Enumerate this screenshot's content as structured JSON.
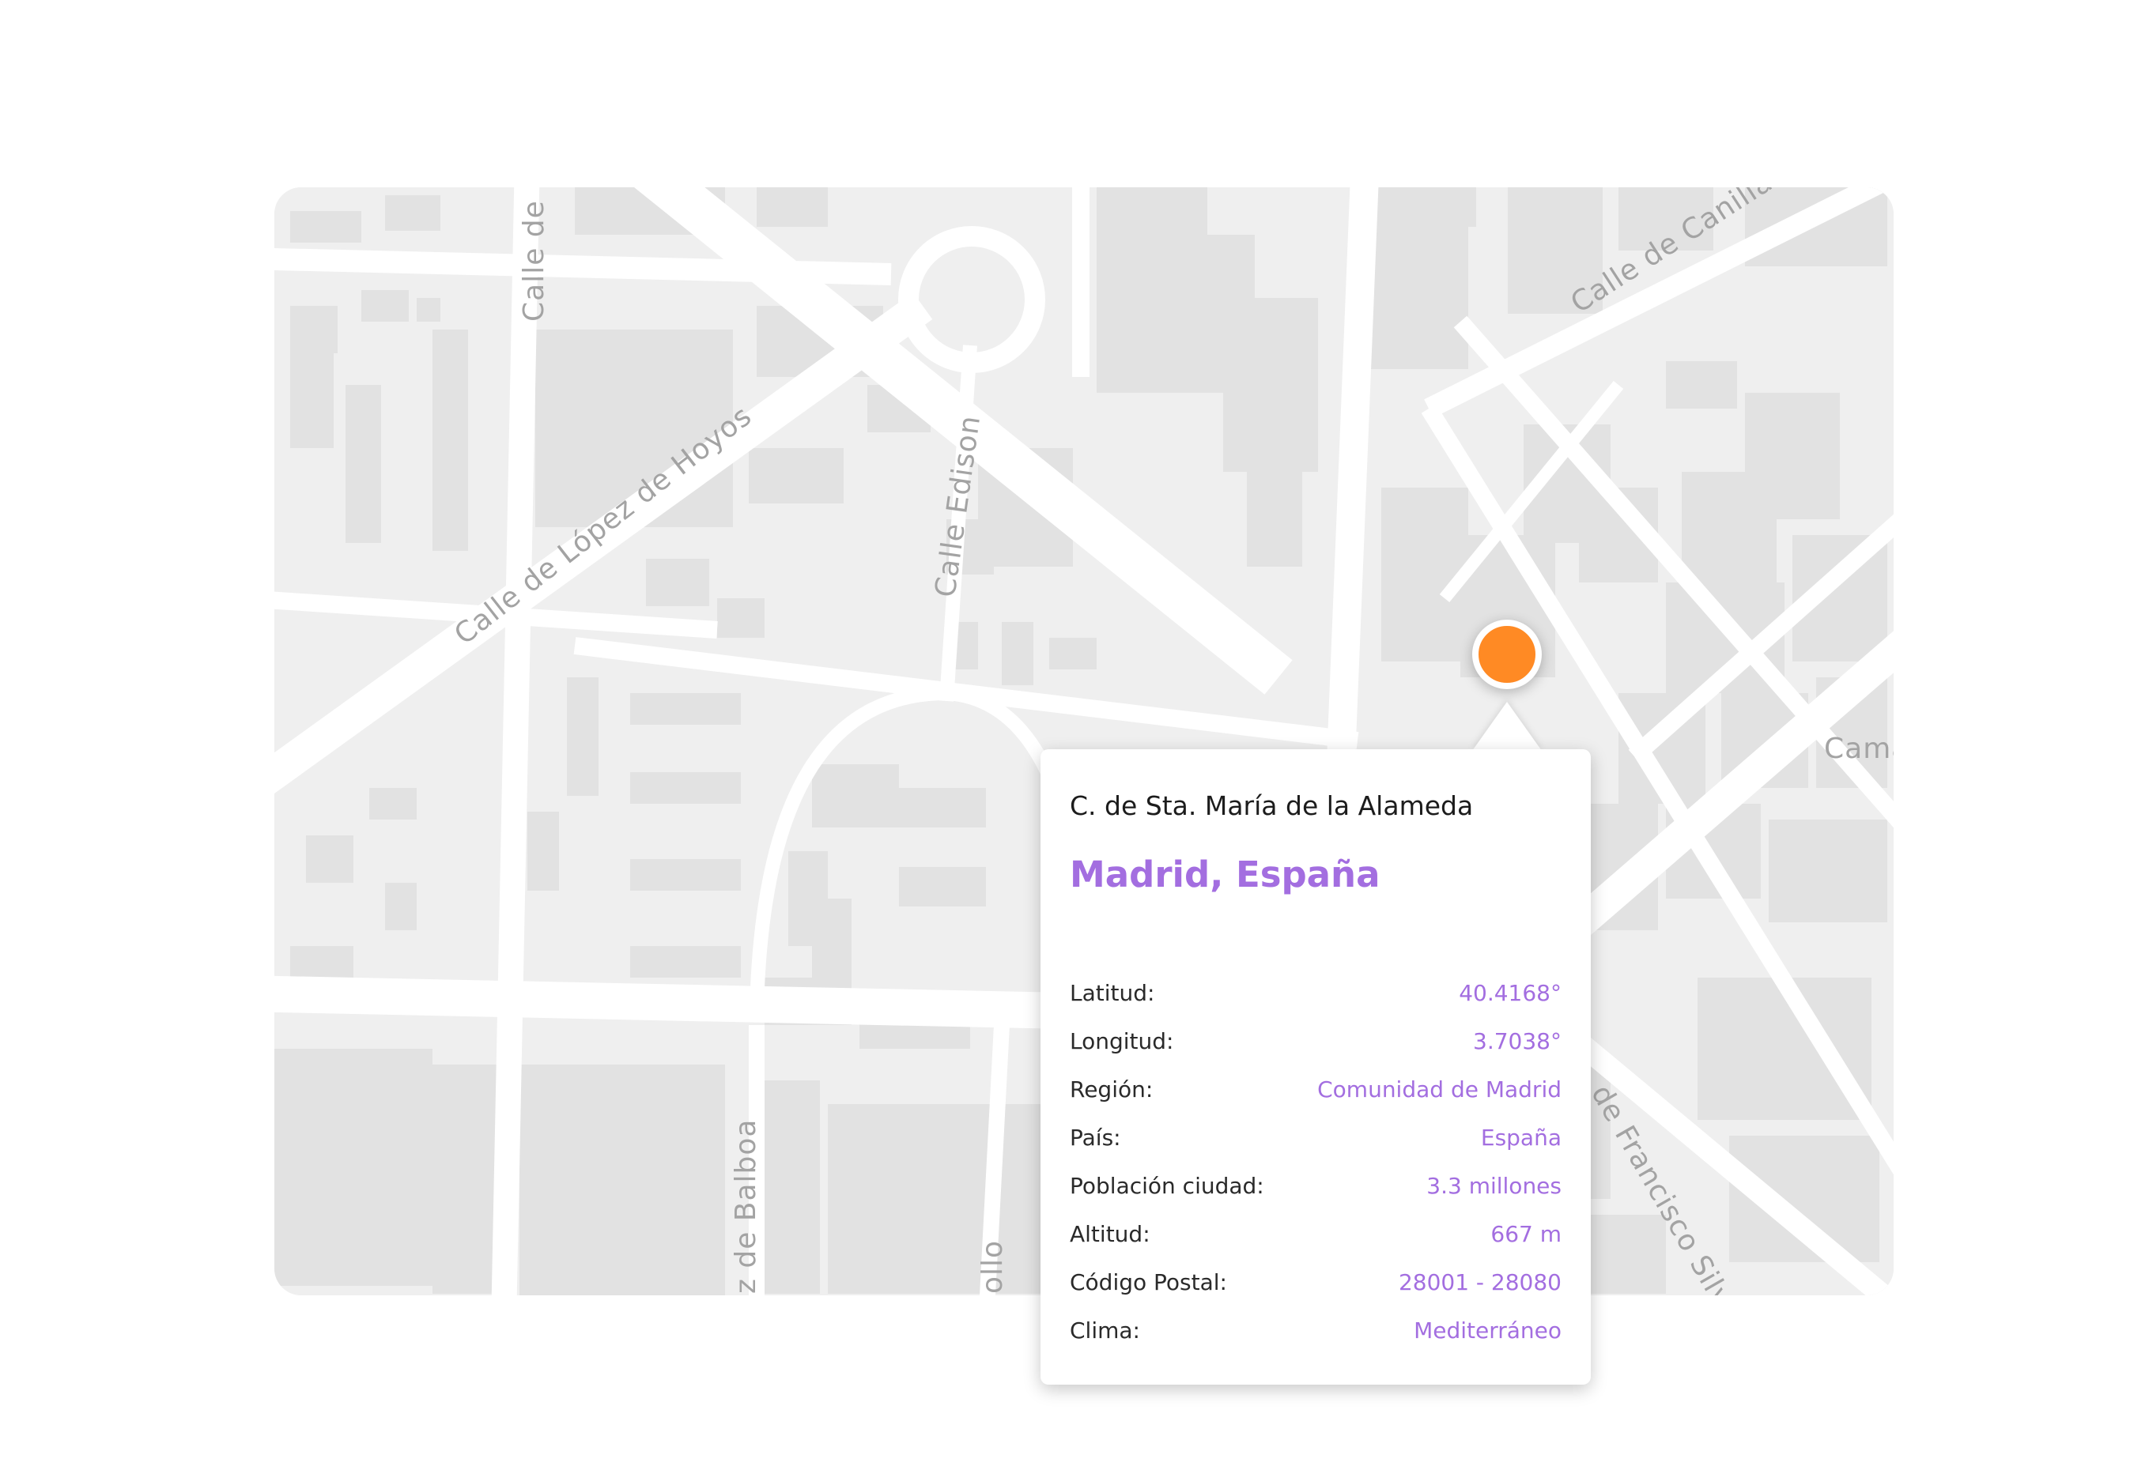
{
  "map": {
    "street_labels": {
      "lopez_de_hoyos": "Calle de López de Hoyos",
      "edison": "Calle Edison",
      "calle_de_top": "Calle de",
      "canillas": "Calle de Canillas",
      "francisco_silvela": "de Francisco Silvela",
      "balboa": "z de Balboa",
      "cama": "Cama",
      "ollo": "ollo"
    }
  },
  "popup": {
    "street": "C. de Sta. María de la Alameda",
    "city": "Madrid, España",
    "details": [
      {
        "label": "Latitud:",
        "value": "40.4168°"
      },
      {
        "label": "Longitud:",
        "value": "3.7038°"
      },
      {
        "label": "Región:",
        "value": "Comunidad de Madrid"
      },
      {
        "label": "País:",
        "value": "España"
      },
      {
        "label": "Población ciudad:",
        "value": "3.3 millones"
      },
      {
        "label": "Altitud:",
        "value": "667 m"
      },
      {
        "label": "Código Postal:",
        "value": "28001 - 28080"
      },
      {
        "label": "Clima:",
        "value": "Mediterráneo"
      }
    ]
  },
  "colors": {
    "marker": "#ff8a24",
    "accent": "#a36ee0",
    "map_background": "#efefef",
    "road": "#ffffff",
    "building": "#e1e1e1"
  }
}
